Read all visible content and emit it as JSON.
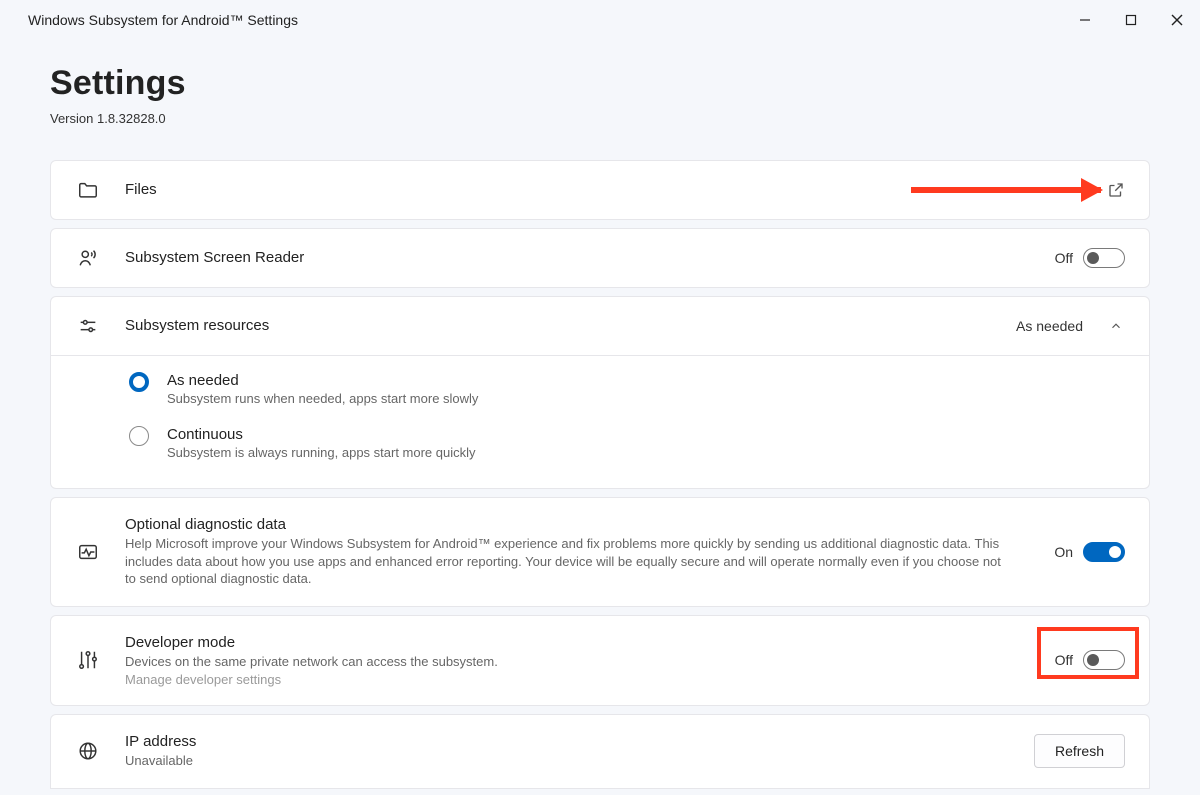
{
  "window": {
    "title": "Windows Subsystem for Android™ Settings"
  },
  "header": {
    "title": "Settings",
    "version": "Version 1.8.32828.0"
  },
  "rows": {
    "files": {
      "label": "Files"
    },
    "screenreader": {
      "label": "Subsystem Screen Reader",
      "state": "Off"
    },
    "resources": {
      "label": "Subsystem resources",
      "summary": "As needed",
      "options": {
        "as_needed": {
          "title": "As needed",
          "desc": "Subsystem runs when needed, apps start more slowly"
        },
        "continuous": {
          "title": "Continuous",
          "desc": "Subsystem is always running, apps start more quickly"
        }
      }
    },
    "diagnostic": {
      "title": "Optional diagnostic data",
      "desc": "Help Microsoft improve your Windows Subsystem for Android™ experience and fix problems more quickly by sending us additional diagnostic data. This includes data about how you use apps and enhanced error reporting. Your device will be equally secure and will operate normally even if you choose not to send optional diagnostic data.",
      "state": "On"
    },
    "devmode": {
      "title": "Developer mode",
      "desc": "Devices on the same private network can access the subsystem.",
      "link": "Manage developer settings",
      "state": "Off"
    },
    "ip": {
      "title": "IP address",
      "desc": "Unavailable",
      "button": "Refresh"
    }
  }
}
